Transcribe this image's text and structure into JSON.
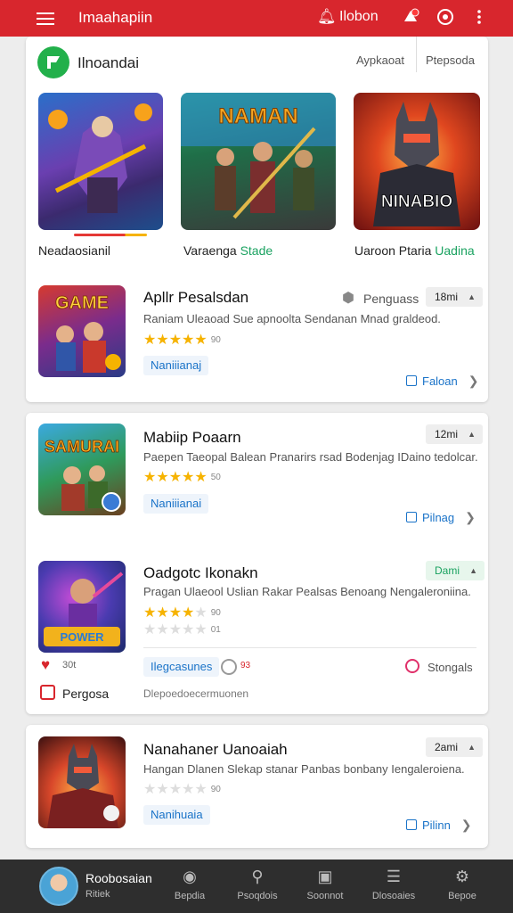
{
  "app": {
    "title": "Imaahapiin",
    "notif_label": "Ilobon"
  },
  "header": {
    "store_name": "Ilnoandai",
    "tab1": "Aypkaoat",
    "tab2": "Ptepsoda"
  },
  "featured": [
    {
      "label": "Neadaosianil",
      "label_accent": ""
    },
    {
      "label": "Varaenga",
      "label_accent": "Stade",
      "banner": "NAMAN"
    },
    {
      "label": "Uaroon Ptaria",
      "label_accent": "Uadina",
      "banner": "NINABIO"
    }
  ],
  "items": [
    {
      "title": "Apllr Pesalsdan",
      "desc": "Raniam Uleaoad Sue apnoolta Sendanan Mnad graldeod.",
      "rating": 5,
      "rating_text": "90",
      "chip": "Naniiianaj",
      "pill": "18mi",
      "extra_label": "Penguass",
      "link": "Faloan"
    },
    {
      "title": "Mabiip Poaarn",
      "desc": "Paepen Taeopal Balean Pranarirs rsad Bodenjag IDaino tedolcar.",
      "rating": 5,
      "rating_text": "50",
      "chip": "Naniiianai",
      "pill": "12mi",
      "link": "Pilnag"
    },
    {
      "title": "Oadgotc Ikonakn",
      "desc": "Pragan Ulaeool Uslian Rakar Pealsas Benoang Nengaleroniina.",
      "rating": 4,
      "rating_text": "90",
      "rating2_text": "01",
      "pill": "Dami",
      "likes": "30t",
      "chip": "Ilegcasunes",
      "chip_extra": "93",
      "right_action": "Stongals",
      "promo": "Pergosa",
      "promo_desc": "Dlepoedoecermuonen"
    },
    {
      "title": "Nanahaner Uanoaiah",
      "desc": "Hangan Dlanen Slekap stanar Panbas bonbany Iengaleroiena.",
      "rating": 0,
      "rating_text": "90",
      "chip": "Nanihuaia",
      "pill": "2ami",
      "link": "Pilinn"
    }
  ],
  "user": {
    "name": "Roobosaian",
    "sub": "Ritiek"
  },
  "nav": [
    {
      "label": "Bepdia",
      "icon": "compass-icon"
    },
    {
      "label": "Psoqdois",
      "icon": "search-icon"
    },
    {
      "label": "Soonnot",
      "icon": "chart-icon"
    },
    {
      "label": "Dlosoaies",
      "icon": "list-icon"
    },
    {
      "label": "Bepoe",
      "icon": "settings-icon"
    }
  ],
  "colors": {
    "accent": "#d8262d",
    "link": "#1a73c8",
    "green": "#1aa260",
    "star": "#f6b300"
  }
}
